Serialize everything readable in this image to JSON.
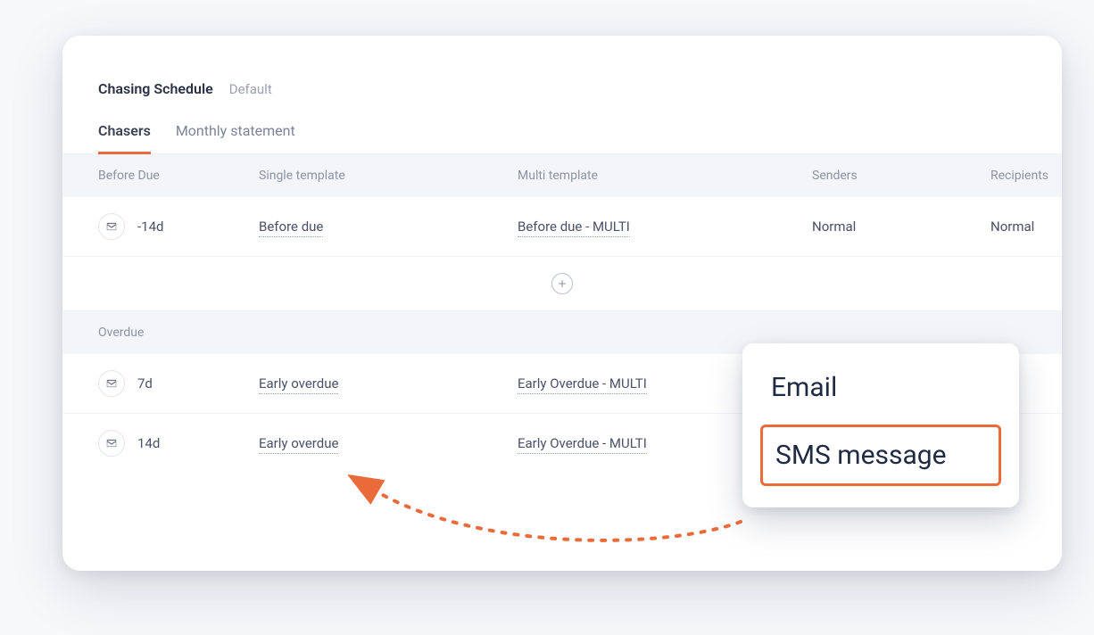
{
  "header": {
    "title": "Chasing Schedule",
    "subtitle": "Default"
  },
  "tabs": {
    "chasers": "Chasers",
    "monthly": "Monthly statement"
  },
  "columns": {
    "before_due": "Before Due",
    "single_template": "Single template",
    "multi_template": "Multi template",
    "senders": "Senders",
    "recipients": "Recipients"
  },
  "sections": {
    "overdue": "Overdue"
  },
  "rows": {
    "before_due_1": {
      "days": "-14d",
      "single": "Before due",
      "multi": "Before due - MULTI",
      "senders": "Normal",
      "recipients": "Normal"
    },
    "overdue_1": {
      "days": "7d",
      "single": "Early overdue",
      "multi": "Early Overdue - MULTI"
    },
    "overdue_2": {
      "days": "14d",
      "single": "Early overdue",
      "multi": "Early Overdue - MULTI"
    }
  },
  "popover": {
    "email": "Email",
    "sms": "SMS message"
  }
}
